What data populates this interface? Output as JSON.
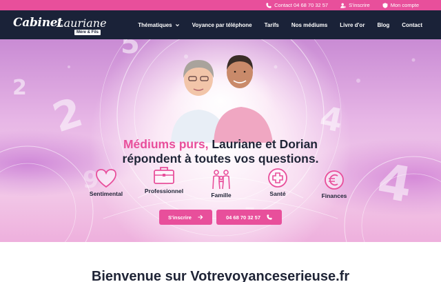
{
  "topbar": {
    "items": [
      {
        "icon": "phone-icon",
        "label": "Contact 04 68 70 32 57"
      },
      {
        "icon": "user-add-icon",
        "label": "S'inscrire"
      },
      {
        "icon": "user-account-icon",
        "label": "Mon compte"
      }
    ]
  },
  "logo": {
    "brand_main": "Cabinet",
    "brand_sub": "Lauriane",
    "tag": "Mère & Fils"
  },
  "nav": {
    "items": [
      "Thématiques",
      "Voyance par téléphone",
      "Tarifs",
      "Nos médiums",
      "Livre d'or",
      "Blog",
      "Contact"
    ]
  },
  "hero": {
    "headline_accent": "Médiums purs,",
    "headline_rest": " Lauriane et Dorian",
    "headline_line2": "répondent à toutes vos questions.",
    "themes": [
      {
        "label": "Sentimental",
        "icon": "heart-icon"
      },
      {
        "label": "Professionnel",
        "icon": "briefcase-icon"
      },
      {
        "label": "Famille",
        "icon": "family-icon"
      },
      {
        "label": "Santé",
        "icon": "health-cross-icon"
      },
      {
        "label": "Finances",
        "icon": "euro-icon"
      }
    ],
    "cta_signup": "S'inscrire",
    "cta_phone": "04 68 70 32 57"
  },
  "welcome": {
    "title": "Bienvenue sur Votrevoyanceserieuse.fr"
  },
  "colors": {
    "accent": "#e84f9b",
    "navy": "#1a2238",
    "text": "#1f2436"
  }
}
